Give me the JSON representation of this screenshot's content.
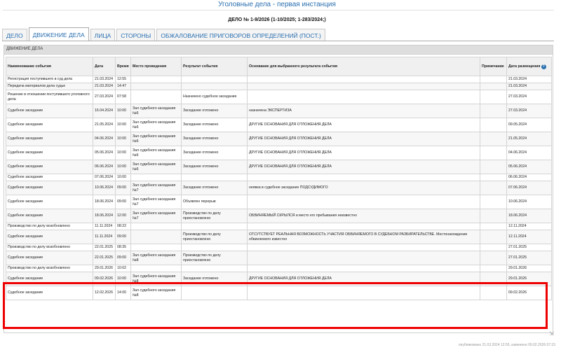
{
  "header": {
    "title": "Уголовные дела - первая инстанция",
    "case_number": "ДЕЛО № 1-9/2026 (1-10/2025; 1-283/2024;)"
  },
  "tabs": [
    {
      "label": "ДЕЛО",
      "active": false
    },
    {
      "label": "ДВИЖЕНИЕ ДЕЛА",
      "active": true
    },
    {
      "label": "ЛИЦА",
      "active": false
    },
    {
      "label": "СТОРОНЫ",
      "active": false
    },
    {
      "label": "ОБЖАЛОВАНИЕ ПРИГОВОРОВ ОПРЕДЕЛЕНИЙ (ПОСТ.)",
      "active": false
    }
  ],
  "panel_title": "ДВИЖЕНИЕ ДЕЛА",
  "columns": [
    "Наименование события",
    "Дата",
    "Время",
    "Место проведения",
    "Результат события",
    "Основание для выбранного результата события",
    "Примечание",
    "Дата размещения"
  ],
  "rows": [
    {
      "event": "Регистрация поступившего в суд дела",
      "date": "21.03.2024",
      "time": "12:55",
      "place": "",
      "result": "",
      "basis": "",
      "note": "",
      "posted": "21.03.2024",
      "h": 10
    },
    {
      "event": "Передача материалов дела судье",
      "date": "21.03.2024",
      "time": "14:47",
      "place": "",
      "result": "",
      "basis": "",
      "note": "",
      "posted": "21.03.2024",
      "h": 10
    },
    {
      "event": "Решение в отношении поступившего уголовного дела",
      "date": "27.03.2024",
      "time": "07:58",
      "place": "",
      "result": "Назначено судебное заседание",
      "basis": "",
      "note": "",
      "posted": "27.03.2024",
      "h": 20
    },
    {
      "event": "Судебное заседание",
      "date": "16.04.2024",
      "time": "10:00",
      "place": "Зал судебного заседания №6",
      "result": "Заседание отложено",
      "basis": "назначена ЭКСПЕРТИЗА",
      "note": "",
      "posted": "27.03.2024",
      "h": 20
    },
    {
      "event": "Судебное заседание",
      "date": "21.05.2024",
      "time": "10:00",
      "place": "Зал судебного заседания №6",
      "result": "Заседание отложено",
      "basis": "ДРУГИЕ ОСНОВАНИЯ ДЛЯ ОТЛОЖЕНИЯ ДЕЛА",
      "note": "",
      "posted": "09.05.2024",
      "h": 20
    },
    {
      "event": "Судебное заседание",
      "date": "04.06.2024",
      "time": "10:00",
      "place": "Зал судебного заседания №6",
      "result": "Заседание отложено",
      "basis": "ДРУГИЕ ОСНОВАНИЯ ДЛЯ ОТЛОЖЕНИЯ ДЕЛА",
      "note": "",
      "posted": "21.05.2024",
      "h": 20
    },
    {
      "event": "Судебное заседание",
      "date": "05.06.2024",
      "time": "10:00",
      "place": "Зал судебного заседания №6",
      "result": "Заседание отложено",
      "basis": "ДРУГИЕ ОСНОВАНИЯ ДЛЯ ОТЛОЖЕНИЯ ДЕЛА",
      "note": "",
      "posted": "04.06.2024",
      "h": 20
    },
    {
      "event": "Судебное заседание",
      "date": "06.06.2024",
      "time": "10:00",
      "place": "Зал судебного заседания №6",
      "result": "Заседание отложено",
      "basis": "ДРУГИЕ ОСНОВАНИЯ ДЛЯ ОТЛОЖЕНИЯ ДЕЛА",
      "note": "",
      "posted": "05.06.2024",
      "h": 20
    },
    {
      "event": "Судебное заседание",
      "date": "07.06.2024",
      "time": "10:00",
      "place": "",
      "result": "",
      "basis": "",
      "note": "",
      "posted": "06.06.2024",
      "h": 10
    },
    {
      "event": "Судебное заседание",
      "date": "10.06.2024",
      "time": "09:00",
      "place": "Зал судебного заседания №7",
      "result": "Заседание отложено",
      "basis": "неявка в судебное заседание ПОДСУДИМОГО",
      "note": "",
      "posted": "07.06.2024",
      "h": 20
    },
    {
      "event": "Судебное заседание",
      "date": "18.06.2024",
      "time": "09:00",
      "place": "Зал судебного заседания №7",
      "result": "Объявлен перерыв",
      "basis": "",
      "note": "",
      "posted": "10.06.2024",
      "h": 20
    },
    {
      "event": "Судебное заседание",
      "date": "18.06.2024",
      "time": "12:00",
      "place": "Зал судебного заседания №7",
      "result": "Производство по делу приостановлено",
      "basis": "ОБВИНЯЕМЫЙ СКРЫЛСЯ и место его пребывания неизвестно",
      "note": "",
      "posted": "18.06.2024",
      "h": 20
    },
    {
      "event": "Производство по делу возобновлено",
      "date": "11.11.2024",
      "time": "08:22",
      "place": "",
      "result": "",
      "basis": "",
      "note": "",
      "posted": "12.11.2024",
      "h": 10
    },
    {
      "event": "Судебное заседание",
      "date": "11.11.2024",
      "time": "09:00",
      "place": "",
      "result": "Производство по делу приостановлено",
      "basis": "ОТСУТСТВУЕТ РЕАЛЬНАЯ ВОЗМОЖНОСТЬ УЧАСТИЯ ОБВИНЯЕМОГО В СУДЕБНОМ РАЗБИРАТЕЛЬСТВЕ. Местонахождение обвиняемого известно",
      "note": "",
      "posted": "12.11.2024",
      "h": 20
    },
    {
      "event": "Производство по делу возобновлено",
      "date": "22.01.2025",
      "time": "08:35",
      "place": "",
      "result": "",
      "basis": "",
      "note": "",
      "posted": "27.01.2025",
      "h": 10
    },
    {
      "event": "Судебное заседание",
      "date": "22.01.2025",
      "time": "09:00",
      "place": "Зал судебного заседания №8",
      "result": "Производство по делу приостановлено",
      "basis": "",
      "note": "",
      "posted": "27.01.2025",
      "h": 20
    },
    {
      "event": "Производство по делу возобновлено",
      "date": "29.01.2026",
      "time": "10:02",
      "place": "",
      "result": "",
      "basis": "",
      "note": "",
      "posted": "29.01.2026",
      "h": 10
    },
    {
      "event": "Судебное заседание",
      "date": "09.02.2026",
      "time": "10:00",
      "place": "Зал судебного заседания №8",
      "result": "Заседание отложено",
      "basis": "ДРУГИЕ ОСНОВАНИЯ ДЛЯ ОТЛОЖЕНИЯ ДЕЛА",
      "note": "",
      "posted": "29.01.2026",
      "h": 20
    },
    {
      "event": "Судебное заседание",
      "date": "12.02.2026",
      "time": "14:00",
      "place": "Зал судебного заседания №8",
      "result": "",
      "basis": "",
      "note": "",
      "posted": "09.02.2026",
      "h": 20
    }
  ],
  "footer": "опубликовано 21.03.2024 12:55, изменено 09.02.2026 07:15",
  "icons": {
    "hint": "question-icon",
    "resize": "resize-handle-icon"
  },
  "colors": {
    "link": "#2a6fb0",
    "highlight": "#e00000"
  }
}
